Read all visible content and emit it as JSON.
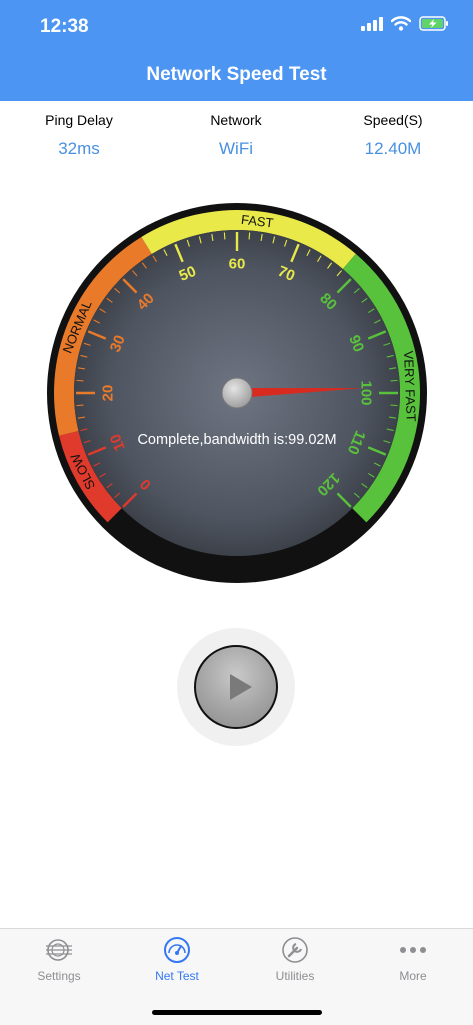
{
  "status": {
    "time": "12:38"
  },
  "header": {
    "title": "Network Speed Test"
  },
  "stats": [
    {
      "label": "Ping Delay",
      "value": "32ms"
    },
    {
      "label": "Network",
      "value": "WiFi"
    },
    {
      "label": "Speed(S)",
      "value": "12.40M"
    }
  ],
  "gauge": {
    "zones": [
      "SLOW",
      "NORMAL",
      "FAST",
      "VERY FAST"
    ],
    "ticks": [
      "0",
      "10",
      "20",
      "30",
      "40",
      "50",
      "60",
      "70",
      "80",
      "90",
      "100",
      "110",
      "120"
    ],
    "status_text": "Complete,bandwidth is:99.02M",
    "needle_value": 99.02,
    "colors": {
      "slow": "#e03a2c",
      "normal": "#e97a2a",
      "fast": "#e9e94a",
      "very_fast": "#59c23c"
    }
  },
  "tabs": [
    {
      "label": "Settings",
      "icon": "settings-stamp-icon"
    },
    {
      "label": "Net Test",
      "icon": "speedometer-icon"
    },
    {
      "label": "Utilities",
      "icon": "wrench-icon"
    },
    {
      "label": "More",
      "icon": "more-dots-icon"
    }
  ]
}
